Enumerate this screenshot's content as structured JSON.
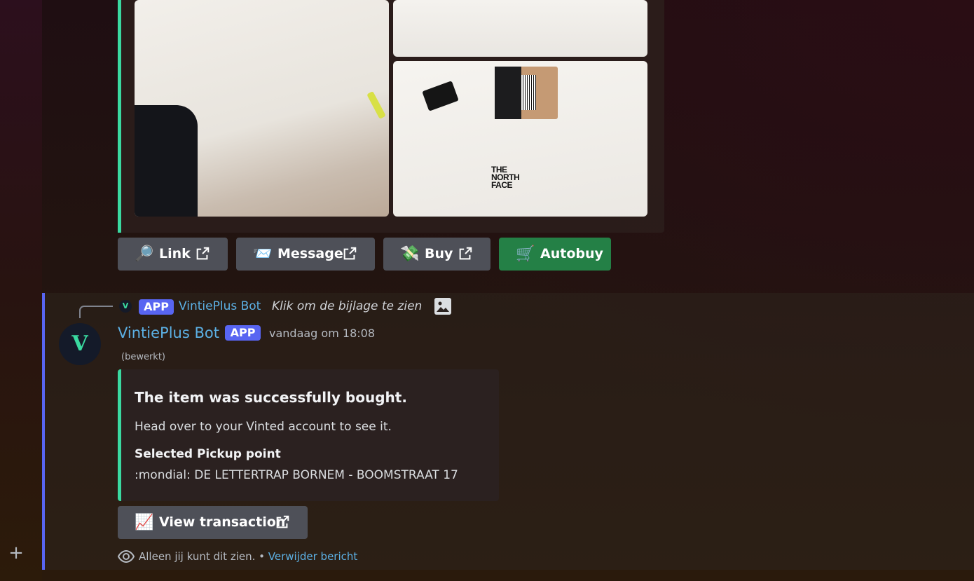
{
  "top_embed": {
    "image_brand_text": "THE NORTH FACE"
  },
  "buttons": {
    "link": {
      "emoji": "🔎",
      "label": "Link"
    },
    "message": {
      "emoji": "📨",
      "label": "Message"
    },
    "buy": {
      "emoji": "💸",
      "label": "Buy"
    },
    "autobuy": {
      "emoji": "🛒",
      "label": "Autobuy"
    }
  },
  "reply": {
    "app_tag": "APP",
    "author": "VintiePlus Bot",
    "text": "Klik om de bijlage te zien"
  },
  "message": {
    "author": "VintiePlus Bot",
    "app_tag": "APP",
    "timestamp": "vandaag om 18:08",
    "edited": "(bewerkt)",
    "embed": {
      "title": "The item was successfully bought.",
      "description": "Head over to your Vinted account to see it.",
      "field_name": "Selected Pickup point",
      "field_value": ":mondial: DE LETTERTRAP BORNEM - BOOMSTRAAT 17"
    },
    "button": {
      "emoji": "📈",
      "label": "View transaction"
    },
    "ephemeral": {
      "note": "Alleen jij kunt dit zien.",
      "separator": " • ",
      "delete_link": "Verwijder bericht"
    }
  },
  "colors": {
    "embed_accent": "#3ad9a0",
    "mention_bar": "#5865f2",
    "username": "#5cb0e4",
    "button_secondary": "#4e5058",
    "button_success": "#248046"
  },
  "icons": [
    "plus-icon",
    "external-link-icon",
    "image-icon",
    "eye-icon",
    "bot-avatar"
  ]
}
